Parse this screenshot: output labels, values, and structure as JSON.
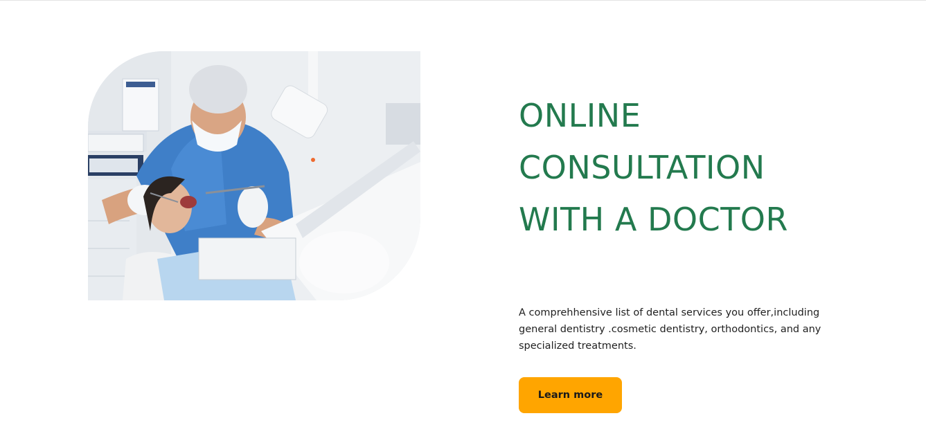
{
  "hero": {
    "image_subject": "dentist-treating-patient-photo",
    "headline_lines": [
      "ONLINE",
      "CONSULTATION",
      "WITH A DOCTOR"
    ],
    "description": "A comprehhensive list of dental services you offer,including general dentistry .cosmetic dentistry, orthodontics, and any specialized treatments.",
    "cta_label": "Learn more"
  },
  "colors": {
    "headline": "#237a4e",
    "cta_background": "#ffa500",
    "body_text": "#1f1f1f",
    "page_background": "#ffffff"
  }
}
